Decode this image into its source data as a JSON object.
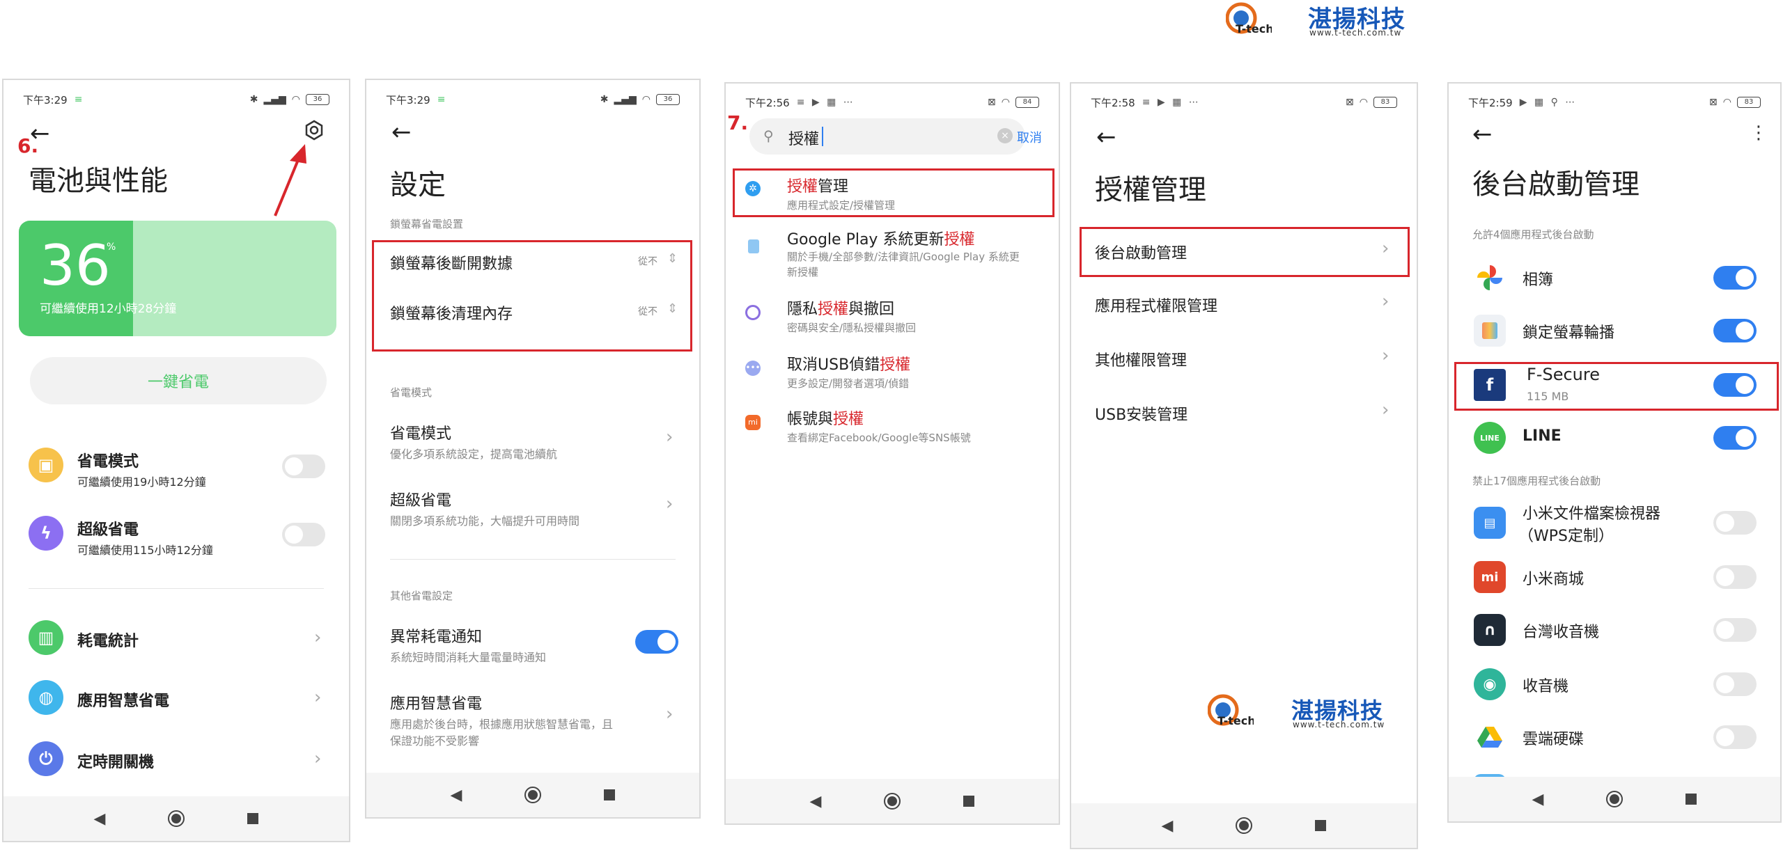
{
  "logo": {
    "brand": "湛揚科技",
    "url": "www.t-tech.com.tw",
    "tech": "T-tech"
  },
  "colors": {
    "accent": "#2f7ff0",
    "highlight": "#d8262c",
    "green": "#4cc96a"
  },
  "panel1": {
    "status_time": "下午3:29",
    "battery": "36",
    "step": "6.",
    "title": "電池與性能",
    "battery_level": 36,
    "battery_percent": "%",
    "remaining": "可繼續使用12小時28分鐘",
    "one_key": "一鍵省電",
    "items": [
      {
        "title": "省電模式",
        "sub": "可繼續使用19小時12分鐘"
      },
      {
        "title": "超級省電",
        "sub": "可繼續使用115小時12分鐘"
      }
    ],
    "links": [
      {
        "title": "耗電統計"
      },
      {
        "title": "應用智慧省電"
      },
      {
        "title": "定時開關機"
      }
    ]
  },
  "panel2": {
    "status_time": "下午3:29",
    "battery": "36",
    "title": "設定",
    "section1": "鎖螢幕省電設置",
    "rows1": [
      {
        "title": "鎖螢幕後斷開數據",
        "value": "從不"
      },
      {
        "title": "鎖螢幕後清理內存",
        "value": "從不"
      }
    ],
    "section2": "省電模式",
    "rows2": [
      {
        "title": "省電模式",
        "sub": "優化多項系統設定，提高電池續航"
      },
      {
        "title": "超級省電",
        "sub": "關閉多項系統功能，大幅提升可用時間"
      }
    ],
    "section3": "其他省電設定",
    "rows3": [
      {
        "title": "異常耗電通知",
        "sub": "系統短時間消耗大量電量時通知"
      },
      {
        "title": "應用智慧省電",
        "sub": "應用處於後台時，根據應用狀態智慧省電，且",
        "sub2": "保證功能不受影響"
      }
    ]
  },
  "panel3": {
    "status_time": "下午2:56",
    "battery": "84",
    "step": "7.",
    "search_value": "授權",
    "cancel": "取消",
    "results": [
      {
        "pre": "",
        "hl": "授權",
        "post": "管理",
        "sub": "應用程式設定/授權管理"
      },
      {
        "pre": "Google Play 系統更新",
        "hl": "授權",
        "post": "",
        "sub": "關於手機/全部參數/法律資訊/Google Play 系統更",
        "sub2": "新授權"
      },
      {
        "pre": "隱私",
        "hl": "授權",
        "post": "與撤回",
        "sub": "密碼與安全/隱私授權與撤回"
      },
      {
        "pre": "取消USB偵錯",
        "hl": "授權",
        "post": "",
        "sub": "更多設定/開發者選項/偵錯"
      },
      {
        "pre": "帳號與",
        "hl": "授權",
        "post": "",
        "sub": "查看綁定Facebook/Google等SNS帳號"
      }
    ]
  },
  "panel4": {
    "status_time": "下午2:58",
    "battery": "83",
    "title": "授權管理",
    "rows": [
      {
        "title": "後台啟動管理"
      },
      {
        "title": "應用程式權限管理"
      },
      {
        "title": "其他權限管理"
      },
      {
        "title": "USB安裝管理"
      }
    ]
  },
  "panel5": {
    "status_time": "下午2:59",
    "battery": "83",
    "title": "後台啟動管理",
    "allowed_section": "允許4個應用程式後台啟動",
    "allowed": [
      {
        "name": "相簿"
      },
      {
        "name": "鎖定螢幕輪播"
      },
      {
        "name": "F-Secure",
        "sub": "115 MB"
      },
      {
        "name": "LINE"
      }
    ],
    "blocked_section": "禁止17個應用程式後台啟動",
    "blocked": [
      {
        "name": "小米文件檔案檢視器",
        "name2": "（WPS定制）"
      },
      {
        "name": "小米商城"
      },
      {
        "name": "台灣收音機"
      },
      {
        "name": "收音機"
      },
      {
        "name": "雲端硬碟"
      }
    ],
    "icon_labels": {
      "fsecure": "f",
      "line": "LINE",
      "mi": "mi",
      "doc": "▤"
    }
  }
}
